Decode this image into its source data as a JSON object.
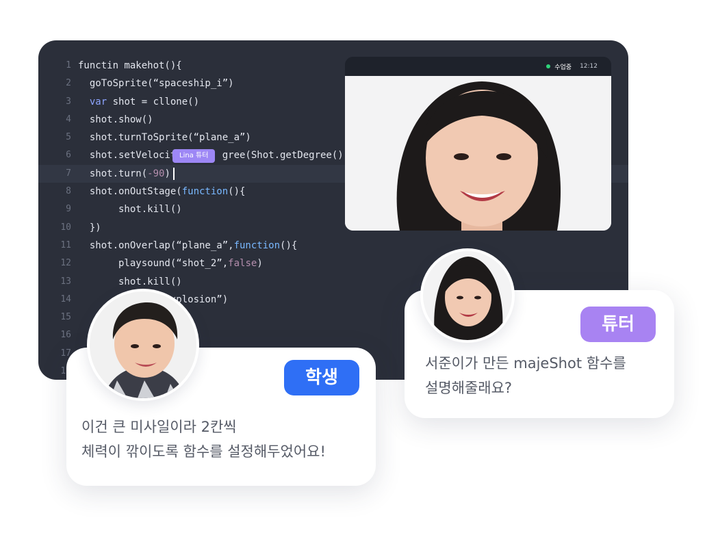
{
  "editor": {
    "lines": [
      {
        "no": "1",
        "parts": [
          {
            "t": "functin makehot(){",
            "c": ""
          }
        ]
      },
      {
        "no": "2",
        "parts": [
          {
            "t": "  goToSprite(“spaceship_i”)",
            "c": ""
          }
        ]
      },
      {
        "no": "3",
        "parts": [
          {
            "t": "  ",
            "c": ""
          },
          {
            "t": "var",
            "c": "kw"
          },
          {
            "t": " shot = cllone()",
            "c": ""
          }
        ]
      },
      {
        "no": "4",
        "parts": [
          {
            "t": "  shot.show()",
            "c": ""
          }
        ]
      },
      {
        "no": "5",
        "parts": [
          {
            "t": "  shot.turnToSprite(“plane_a”)",
            "c": ""
          }
        ]
      },
      {
        "no": "6",
        "parts": [
          {
            "t": "  shot.setVelocit        gree(Shot.getDegree(),",
            "c": ""
          }
        ]
      },
      {
        "no": "7",
        "parts": [
          {
            "t": "  shot.turn(",
            "c": ""
          },
          {
            "t": "-90",
            "c": "num"
          },
          {
            "t": ")",
            "c": ""
          }
        ]
      },
      {
        "no": "8",
        "parts": [
          {
            "t": "  shot.onOutStage(",
            "c": ""
          },
          {
            "t": "function",
            "c": "kw2"
          },
          {
            "t": "(){",
            "c": ""
          }
        ]
      },
      {
        "no": "9",
        "parts": [
          {
            "t": "       shot.kill()",
            "c": ""
          }
        ]
      },
      {
        "no": "10",
        "parts": [
          {
            "t": "  })",
            "c": ""
          }
        ]
      },
      {
        "no": "11",
        "parts": [
          {
            "t": "  shot.onOverlap(“plane_a”,",
            "c": ""
          },
          {
            "t": "function",
            "c": "kw2"
          },
          {
            "t": "(){",
            "c": ""
          }
        ]
      },
      {
        "no": "12",
        "parts": [
          {
            "t": "       playsound(“shot_2”,",
            "c": ""
          },
          {
            "t": "false",
            "c": "bool"
          },
          {
            "t": ")",
            "c": ""
          }
        ]
      },
      {
        "no": "13",
        "parts": [
          {
            "t": "       shot.kill()",
            "c": ""
          }
        ]
      },
      {
        "no": "14",
        "parts": [
          {
            "t": "            d(“explosion”)",
            "c": ""
          }
        ]
      },
      {
        "no": "15",
        "parts": []
      },
      {
        "no": "16",
        "parts": []
      },
      {
        "no": "17",
        "parts": []
      },
      {
        "no": "18",
        "parts": []
      }
    ],
    "active_line": 7,
    "tutor_tag": "Lina 튜터"
  },
  "video": {
    "status": "수업중",
    "time": "12:12"
  },
  "student_card": {
    "badge": "학생",
    "message": "이건 큰 미사일이라 2칸씩\n체력이 깎이도록 함수를 설정해두었어요!"
  },
  "tutor_card": {
    "badge": "튜터",
    "message": "서준이가 만든 majeShot 함수를\n설명해줄래요?"
  },
  "icons": {
    "recording": "recording-dot-icon"
  },
  "colors": {
    "editor_bg": "#2b2f3a",
    "student_accent": "#2f6ff5",
    "tutor_accent": "#a883f2",
    "live_dot": "#2ed47a"
  }
}
